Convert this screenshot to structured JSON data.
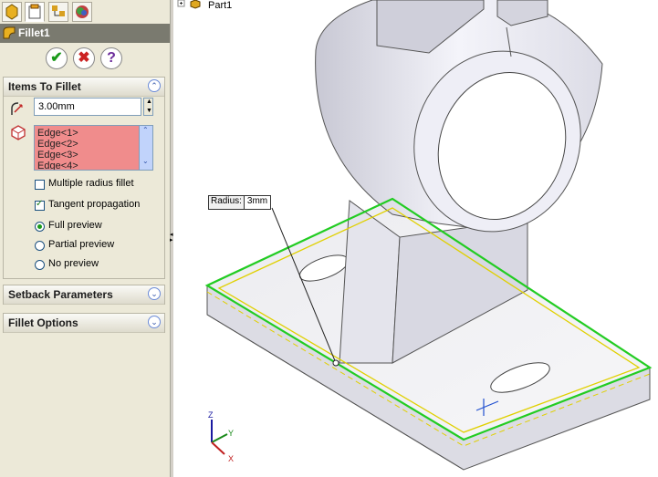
{
  "tree": {
    "part_label": "Part1"
  },
  "panel": {
    "title": "Fillet1",
    "tabs": [
      {
        "icon": "feature-manager-icon"
      },
      {
        "icon": "property-manager-icon"
      },
      {
        "icon": "configuration-manager-icon"
      },
      {
        "icon": "display-manager-icon"
      }
    ],
    "buttons": {
      "ok": "✔",
      "cancel": "✖",
      "help": "?"
    },
    "items_to_fillet": {
      "header": "Items To Fillet",
      "radius_value": "3.00mm",
      "edges": [
        "Edge<1>",
        "Edge<2>",
        "Edge<3>",
        "Edge<4>"
      ],
      "multiple_radius_label": "Multiple radius fillet",
      "tangent_propagation_label": "Tangent propagation",
      "full_preview_label": "Full preview",
      "partial_preview_label": "Partial preview",
      "no_preview_label": "No preview"
    },
    "setback_header": "Setback Parameters",
    "fillet_options_header": "Fillet Options"
  },
  "callout": {
    "label": "Radius:",
    "value": "3mm"
  },
  "triad": {
    "x": "X",
    "y": "Y",
    "z": "Z"
  },
  "colors": {
    "selection": "#22cc22",
    "preview": "#e0d000",
    "edge_list_bg": "#f08c8c",
    "title_bar": "#7a7a6f"
  }
}
